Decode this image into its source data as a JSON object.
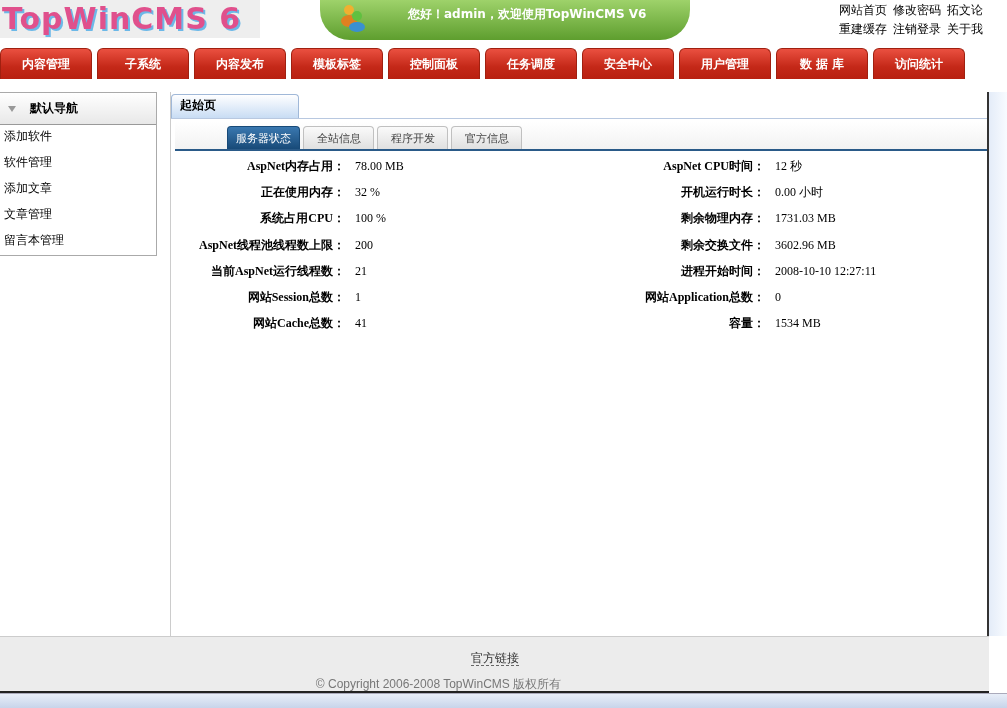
{
  "header": {
    "logo": "TopWinCMS 6",
    "greeting": "您好！admin，欢迎使用TopWinCMS V6",
    "links_top": [
      "网站首页",
      "修改密码",
      "拓文论"
    ],
    "links_bottom": [
      "重建缓存",
      "注销登录",
      "关于我"
    ]
  },
  "menu": [
    {
      "label": "内容管理",
      "selected": false
    },
    {
      "label": "子系统",
      "selected": false
    },
    {
      "label": "内容发布",
      "selected": false
    },
    {
      "label": "模板标签",
      "selected": false
    },
    {
      "label": "控制面板",
      "selected": false
    },
    {
      "label": "任务调度",
      "selected": false
    },
    {
      "label": "安全中心",
      "selected": false
    },
    {
      "label": "用户管理",
      "selected": false
    },
    {
      "label": "数 据 库",
      "selected": false
    },
    {
      "label": "访问统计",
      "selected": false
    }
  ],
  "sidebar": {
    "title": "默认导航",
    "expanded": true,
    "items": [
      "添加软件",
      "软件管理",
      "添加文章",
      "文章管理",
      "留言本管理"
    ]
  },
  "page_tab": "起始页",
  "tabs": [
    {
      "label": "服务器状态",
      "selected": true
    },
    {
      "label": "全站信息",
      "selected": false
    },
    {
      "label": "程序开发",
      "selected": false
    },
    {
      "label": "官方信息",
      "selected": false
    }
  ],
  "stats": [
    {
      "label": "AspNet内存占用：",
      "value": "78.00 MB",
      "label_2": "AspNet CPU时间：",
      "value_2": "12 秒"
    },
    {
      "label": "正在使用内存：",
      "value": "32 %",
      "label_2": "开机运行时长：",
      "value_2": "0.00 小时"
    },
    {
      "label": "系统占用CPU：",
      "value": "100 %",
      "label_2": "剩余物理内存：",
      "value_2": "1731.03 MB"
    },
    {
      "label": "AspNet线程池线程数上限：",
      "value": "200",
      "label_2": "剩余交换文件：",
      "value_2": "3602.96 MB"
    },
    {
      "label": "当前AspNet运行线程数：",
      "value": "21",
      "label_2": "进程开始时间：",
      "value_2": "2008-10-10 12:27:11"
    },
    {
      "label": "网站Session总数：",
      "value": "1",
      "label_2": "网站Application总数：",
      "value_2": "0"
    },
    {
      "label": "网站Cache总数：",
      "value": "41",
      "label_2": "容量：",
      "value_2": "1534 MB"
    }
  ],
  "footer": {
    "link": "官方链接",
    "copyright": "© Copyright 2006-2008 TopWinCMS 版权所有"
  }
}
